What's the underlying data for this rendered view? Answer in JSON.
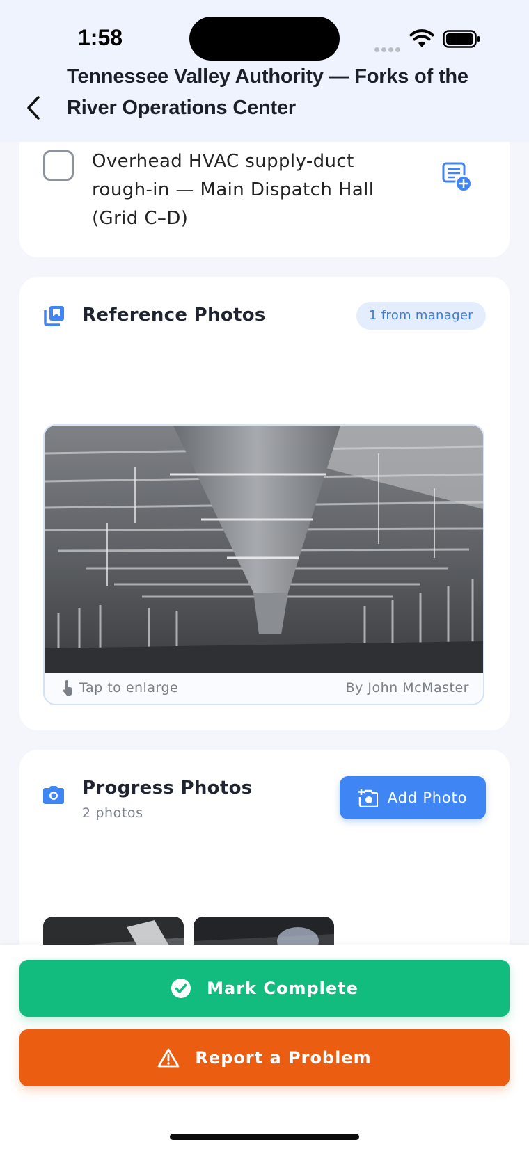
{
  "status_bar": {
    "time": "1:58"
  },
  "header": {
    "title": "Tennessee Valley Authority — Forks of the River Operations Center"
  },
  "task": {
    "text": "Overhead HVAC supply-duct rough-in — Main Dispatch Hall (Grid C–D)",
    "checked": false
  },
  "reference_photos": {
    "title": "Reference Photos",
    "badge": "1 from manager",
    "caption_hint": "Tap to enlarge",
    "caption_author": "By John McMaster"
  },
  "progress_photos": {
    "title": "Progress Photos",
    "count_label": "2 photos",
    "add_button": "Add Photo"
  },
  "actions": {
    "complete": "Mark Complete",
    "problem": "Report a Problem"
  },
  "colors": {
    "accent_blue": "#3f86f4",
    "complete_green": "#12bb7e",
    "problem_orange": "#eb5e11",
    "header_bg": "#eef3fd"
  }
}
